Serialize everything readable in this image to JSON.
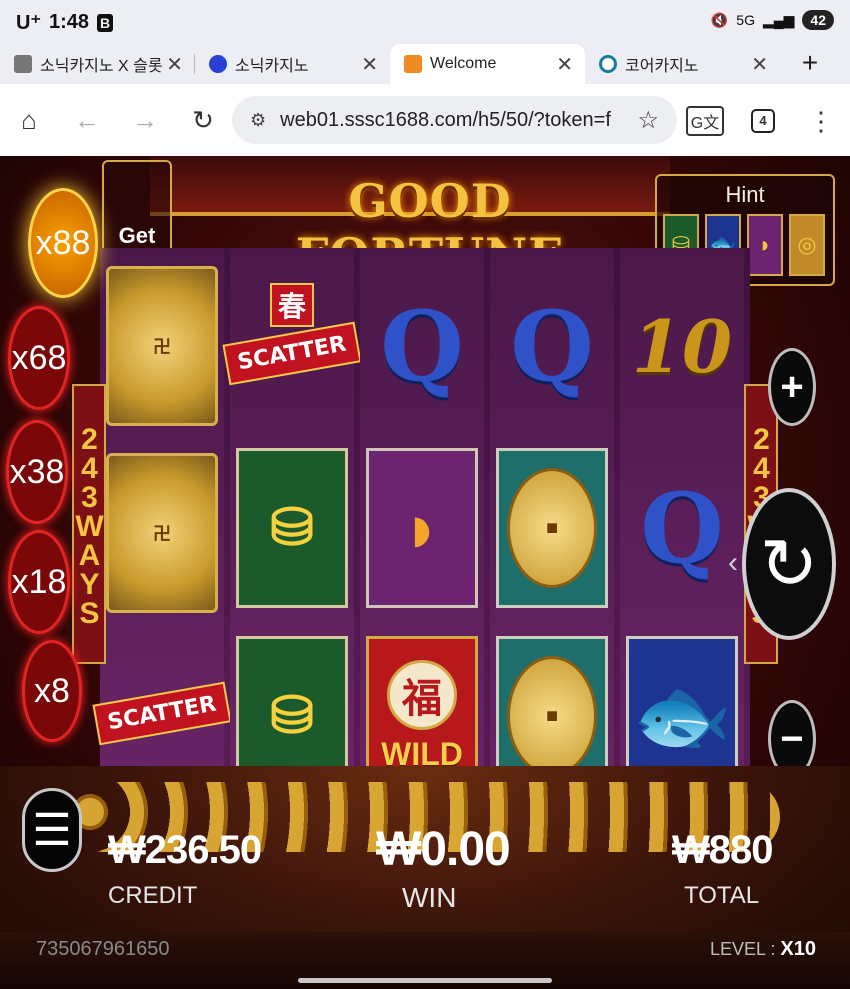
{
  "status": {
    "carrier": "U⁺",
    "time": "1:48",
    "app_badge": "B",
    "network": "5G",
    "battery": "42"
  },
  "tabs": [
    {
      "label": "소닉카지노 X 슬롯",
      "favicon_color": "#777777"
    },
    {
      "label": "소닉카지노",
      "favicon_color": "#2a3fd6"
    },
    {
      "label": "Welcome",
      "favicon_color": "#f08a22"
    },
    {
      "label": "코어카지노",
      "favicon_color": "#1a7aa0"
    }
  ],
  "toolbar": {
    "url": "web01.sssc1688.com/h5/50/?token=f",
    "tab_count": "4"
  },
  "game": {
    "title": "GOOD FORTUNE",
    "get_more": "Get More",
    "hint_label": "Hint",
    "ways_left": "243WAYS",
    "ways_right": "243WAYS",
    "multipliers": [
      "x88",
      "x68",
      "x38",
      "x18",
      "x8"
    ],
    "reels": [
      [
        "coin",
        "coin",
        "scatter"
      ],
      [
        "scatter",
        "ingot",
        "ingot"
      ],
      [
        "Q",
        "fan",
        "wild"
      ],
      [
        "Q",
        "coin2",
        "coin2"
      ],
      [
        "10",
        "Q",
        "fish"
      ]
    ],
    "scatter_label": "SCATTER",
    "scatter_char": "春",
    "wild_label": "WILD",
    "wild_char": "福",
    "credit_amount": "₩236.50",
    "credit_label": "CREDIT",
    "win_amount": "₩0.00",
    "win_label": "WIN",
    "total_amount": "₩880",
    "total_label": "TOTAL",
    "player_id": "735067961650",
    "level_label": "LEVEL :",
    "level_value": "X10"
  }
}
